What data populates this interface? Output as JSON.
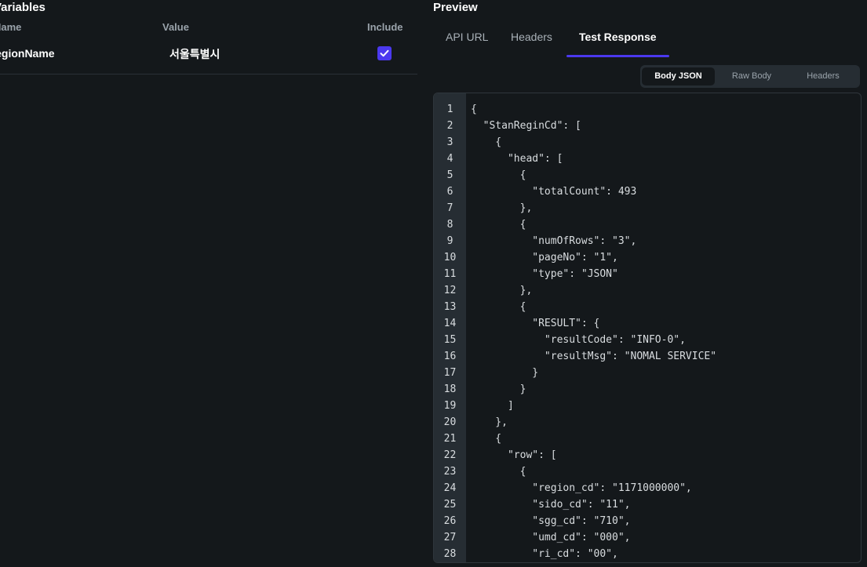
{
  "variables": {
    "title": "Variables",
    "columns": {
      "name": "Name",
      "value": "Value",
      "include": "Include"
    },
    "row": {
      "name": "RegionName",
      "value": "서울특별시",
      "include": true
    }
  },
  "preview": {
    "title": "Preview",
    "tabs": [
      "API URL",
      "Headers",
      "Test Response"
    ],
    "active_tab": "Test Response",
    "response_tabs": [
      "Body JSON",
      "Raw Body",
      "Headers"
    ],
    "active_response_tab": "Body JSON",
    "code_lines": [
      "{",
      "  \"StanReginCd\": [",
      "    {",
      "      \"head\": [",
      "        {",
      "          \"totalCount\": 493",
      "        },",
      "        {",
      "          \"numOfRows\": \"3\",",
      "          \"pageNo\": \"1\",",
      "          \"type\": \"JSON\"",
      "        },",
      "        {",
      "          \"RESULT\": {",
      "            \"resultCode\": \"INFO-0\",",
      "            \"resultMsg\": \"NOMAL SERVICE\"",
      "          }",
      "        }",
      "      ]",
      "    },",
      "    {",
      "      \"row\": [",
      "        {",
      "          \"region_cd\": \"1171000000\",",
      "          \"sido_cd\": \"11\",",
      "          \"sgg_cd\": \"710\",",
      "          \"umd_cd\": \"000\",",
      "          \"ri_cd\": \"00\","
    ]
  },
  "colors": {
    "accent": "#4b39ef",
    "background": "#14181b",
    "panel": "#262d33"
  }
}
